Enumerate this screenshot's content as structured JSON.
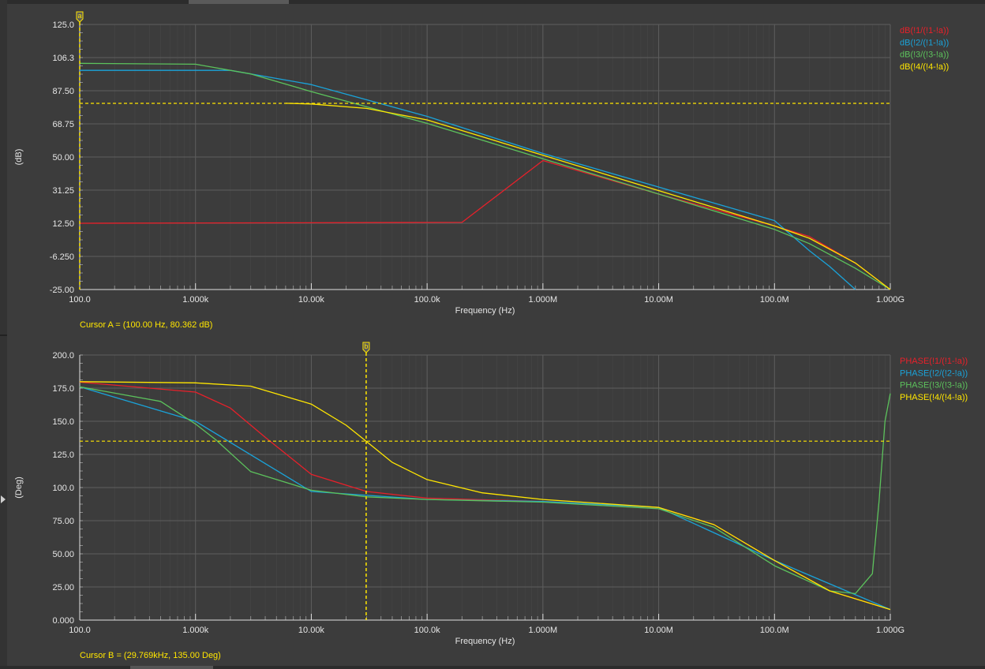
{
  "colors": {
    "background": "#3c3c3c",
    "grid": "#5e5e5e",
    "axis": "#e0e0e0",
    "text": "#e6e6e6",
    "cursor": "#ffe600",
    "series": [
      "#e8202a",
      "#1aa3d9",
      "#5cc25c",
      "#ffe600"
    ]
  },
  "chart_data": [
    {
      "type": "line",
      "xscale": "log",
      "xlim": [
        100,
        1000000000
      ],
      "ylim": [
        -25,
        125
      ],
      "xlabel": "Frequency (Hz)",
      "ylabel": "(dB)",
      "xtick_labels": [
        "100.0",
        "1.000k",
        "10.00k",
        "100.0k",
        "1.000M",
        "10.00M",
        "100.0M",
        "1.000G"
      ],
      "ytick_labels": [
        "125.0",
        "106.3",
        "87.50",
        "68.75",
        "50.00",
        "31.25",
        "12.50",
        "-6.250",
        "-25.00"
      ],
      "grid": true,
      "legend": "top-right",
      "cursor": {
        "marker": "a",
        "x": 100,
        "y": 80.362,
        "readout": "Cursor A = (100.00 Hz, 80.362 dB)"
      },
      "series": [
        {
          "name": "dB(!1/(!1-!a))",
          "color": "#e8202a",
          "x": [
            100,
            200000,
            1000000,
            10000000,
            100000000,
            200000000,
            500000000,
            1000000000
          ],
          "y": [
            12.5,
            13,
            48,
            29,
            11,
            5,
            -10,
            -25
          ]
        },
        {
          "name": "dB(!2/(!1-!a))",
          "color": "#1aa3d9",
          "x": [
            100,
            2000,
            10000,
            100000,
            1000000,
            10000000,
            100000000,
            200000000,
            300000000,
            500000000
          ],
          "y": [
            99,
            99,
            91,
            73,
            52,
            33,
            14,
            -3,
            -12,
            -25
          ]
        },
        {
          "name": "dB(!3/(!3-!a))",
          "color": "#5cc25c",
          "x": [
            100,
            1000,
            3000,
            10000,
            100000,
            1000000,
            10000000,
            100000000,
            200000000,
            500000000,
            1000000000
          ],
          "y": [
            103,
            102.5,
            97,
            87,
            69,
            49,
            29,
            9,
            1,
            -13,
            -25
          ]
        },
        {
          "name": "dB(!4/(!4-!a))",
          "color": "#ffe600",
          "x": [
            6000,
            10000,
            30000,
            100000,
            1000000,
            10000000,
            100000000,
            200000000,
            500000000,
            1000000000
          ],
          "y": [
            80.4,
            80,
            77.5,
            71,
            51,
            31,
            11,
            4,
            -10,
            -25
          ]
        }
      ]
    },
    {
      "type": "line",
      "xscale": "log",
      "xlim": [
        100,
        1000000000
      ],
      "ylim": [
        0,
        200
      ],
      "xlabel": "Frequency (Hz)",
      "ylabel": "(Deg)",
      "xtick_labels": [
        "100.0",
        "1.000k",
        "10.00k",
        "100.0k",
        "1.000M",
        "10.00M",
        "100.0M",
        "1.000G"
      ],
      "ytick_labels": [
        "200.0",
        "175.0",
        "150.0",
        "125.0",
        "100.0",
        "75.00",
        "50.00",
        "25.00",
        "0.000"
      ],
      "grid": true,
      "legend": "top-right",
      "cursor": {
        "marker": "b",
        "x": 29769,
        "y": 135,
        "readout": "Cursor B = (29.769kHz, 135.00 Deg)"
      },
      "series": [
        {
          "name": "PHASE(!1/(!1-!a))",
          "color": "#e8202a",
          "x": [
            100,
            1000,
            2000,
            4000,
            10000,
            30000,
            100000,
            1000000,
            10000000,
            30000000,
            100000000,
            300000000,
            1000000000
          ],
          "y": [
            179.5,
            172,
            160,
            138,
            110,
            97,
            92,
            89.5,
            85,
            72,
            45,
            22,
            8
          ]
        },
        {
          "name": "PHASE(!2/(!2-!a))",
          "color": "#1aa3d9",
          "x": [
            100,
            1000,
            10000,
            100000,
            1000000,
            10000000,
            100000000,
            1000000000
          ],
          "y": [
            176,
            150,
            97,
            91,
            89.5,
            85,
            45,
            8
          ]
        },
        {
          "name": "PHASE(!3/(!3-!a))",
          "color": "#5cc25c",
          "x": [
            100,
            500,
            1000,
            1500,
            3000,
            10000,
            30000,
            100000,
            1000000,
            10000000,
            30000000,
            100000000,
            300000000,
            500000000,
            700000000,
            800000000,
            900000000,
            1000000000
          ],
          "y": [
            176,
            165,
            148,
            136,
            112,
            98,
            93,
            91,
            89,
            84,
            70,
            41,
            22,
            20,
            35,
            90,
            150,
            171
          ]
        },
        {
          "name": "PHASE(!4/(!4-!a))",
          "color": "#ffe600",
          "x": [
            100,
            1000,
            3000,
            10000,
            20000,
            29769,
            50000,
            100000,
            300000,
            1000000,
            10000000,
            30000000,
            100000000,
            300000000,
            1000000000
          ],
          "y": [
            179.9,
            179,
            176.5,
            163,
            147,
            135,
            119,
            106,
            96,
            91,
            85,
            72,
            45,
            22,
            8
          ]
        }
      ]
    }
  ]
}
